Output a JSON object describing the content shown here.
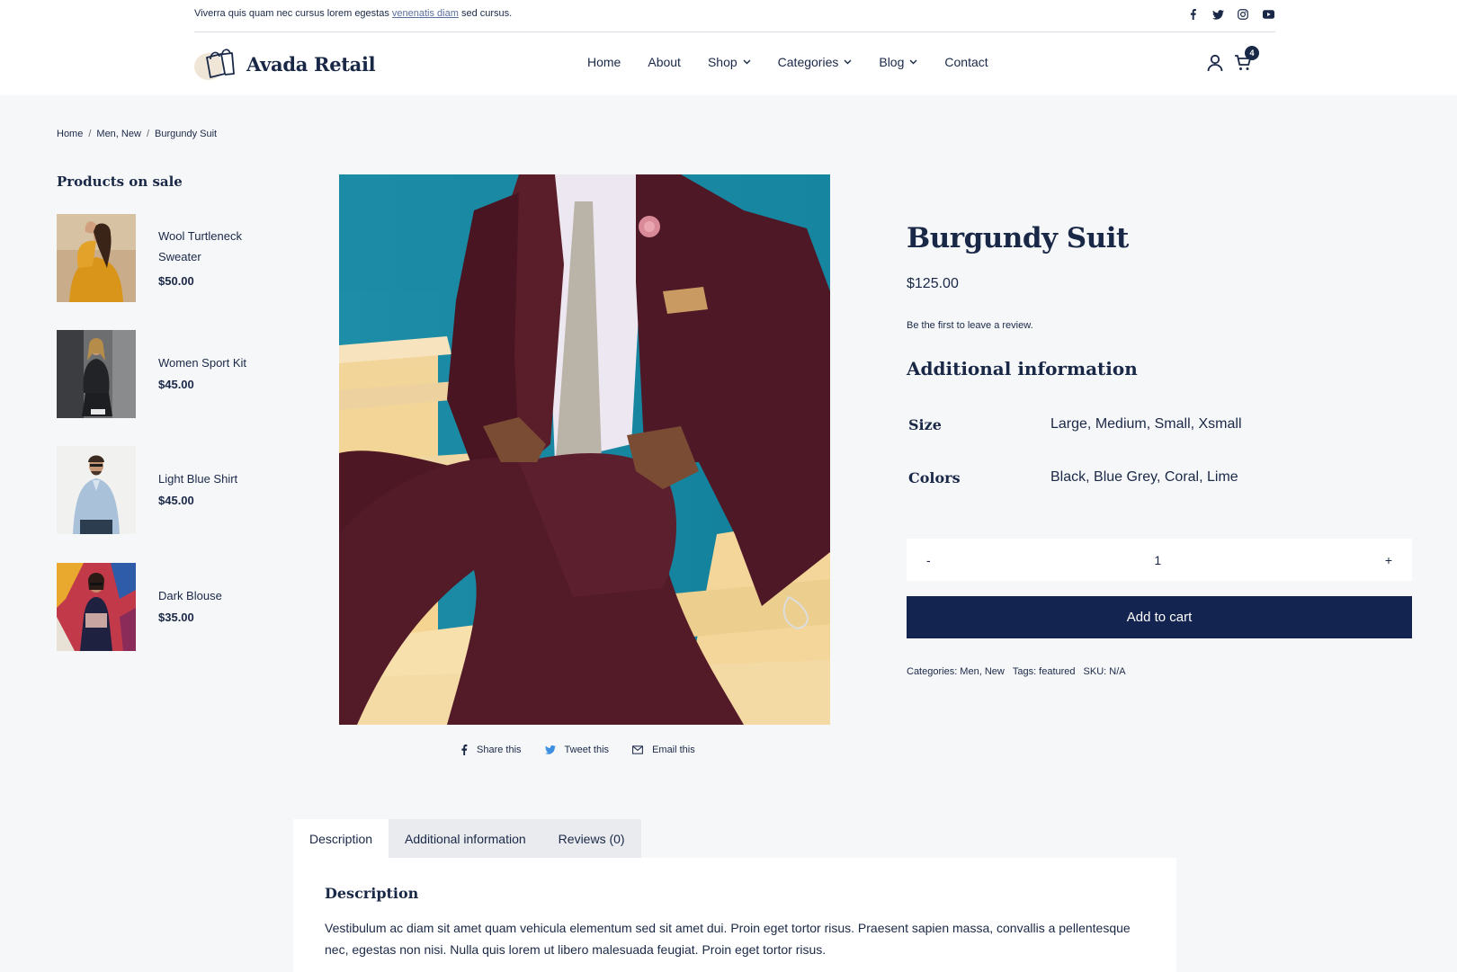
{
  "topbar": {
    "text_before": "Viverra quis quam nec cursus lorem egestas",
    "link": "venenatis diam",
    "text_after": "sed cursus."
  },
  "social_icons": [
    "facebook-icon",
    "twitter-icon",
    "instagram-icon",
    "youtube-icon"
  ],
  "header": {
    "logo_text": "Avada Retail",
    "nav": [
      "Home",
      "About",
      "Shop",
      "Categories",
      "Blog",
      "Contact"
    ],
    "cart_count": "4"
  },
  "breadcrumb": [
    "Home",
    "Men, New",
    "Burgundy Suit"
  ],
  "sidebar": {
    "title": "Products on sale",
    "items": [
      {
        "name": "Wool Turtleneck Sweater",
        "price": "$50.00"
      },
      {
        "name": "Women Sport Kit",
        "price": "$45.00"
      },
      {
        "name": "Light Blue Shirt",
        "price": "$45.00"
      },
      {
        "name": "Dark Blouse",
        "price": "$35.00"
      }
    ]
  },
  "share": [
    "Share this",
    "Tweet this",
    "Email this"
  ],
  "product": {
    "title": "Burgundy Suit",
    "price": "$125.00",
    "review_prompt": "Be the first to leave a review.",
    "additional_title": "Additional information",
    "attributes": [
      {
        "label": "Size",
        "value": "Large, Medium, Small, Xsmall"
      },
      {
        "label": "Colors",
        "value": "Black, Blue Grey, Coral, Lime"
      }
    ],
    "qty_minus": "-",
    "qty_value": "1",
    "qty_plus": "+",
    "add_to_cart": "Add to cart",
    "meta": {
      "categories": "Categories: Men, New",
      "tags": "Tags: featured",
      "sku": "SKU: N/A"
    }
  },
  "tabs": [
    "Description",
    "Additional information",
    "Reviews (0)"
  ],
  "description": {
    "title": "Description",
    "text": "Vestibulum ac diam sit amet quam vehicula elementum sed sit amet dui. Proin eget tortor risus. Praesent sapien massa, convallis a pellentesque nec, egestas non nisi. Nulla quis lorem ut libero malesuada feugiat. Proin eget tortor risus."
  },
  "colors": {
    "primary": "#142450",
    "background": "#f6f7f9"
  }
}
